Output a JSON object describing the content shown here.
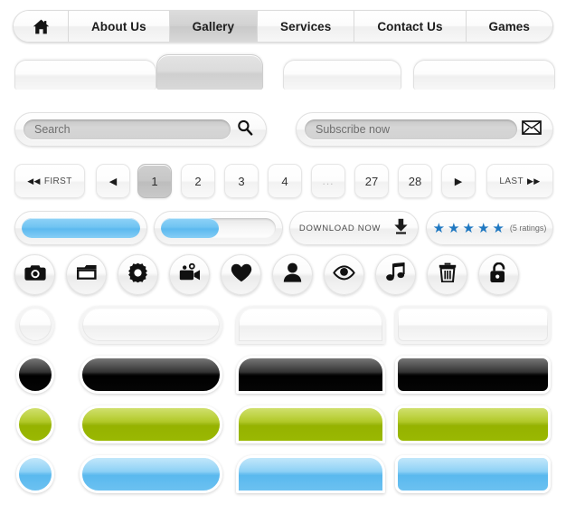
{
  "navbar": {
    "home_icon": "home-icon",
    "items": [
      {
        "label": "About Us",
        "active": false
      },
      {
        "label": "Gallery",
        "active": true
      },
      {
        "label": "Services",
        "active": false
      },
      {
        "label": "Contact Us",
        "active": false
      },
      {
        "label": "Games",
        "active": false
      }
    ]
  },
  "tabs": [
    {
      "label": "",
      "active": false
    },
    {
      "label": "",
      "active": true
    },
    {
      "label": "",
      "active": false
    },
    {
      "label": "",
      "active": false
    }
  ],
  "search": {
    "value": "Search",
    "placeholder": "Search",
    "icon": "search-icon"
  },
  "subscribe": {
    "value": "Subscribe now",
    "placeholder": "Subscribe now",
    "icon": "envelope-icon"
  },
  "pagination": {
    "first_label": "FIRST",
    "last_label": "LAST",
    "prev_icon": "chevron-left-icon",
    "next_icon": "chevron-right-icon",
    "first_icon": "double-chevron-left-icon",
    "last_icon": "double-chevron-right-icon",
    "pages": [
      {
        "label": "1",
        "active": true
      },
      {
        "label": "2",
        "active": false
      },
      {
        "label": "3",
        "active": false
      },
      {
        "label": "4",
        "active": false
      },
      {
        "label": "...",
        "active": false,
        "ellipsis": true
      },
      {
        "label": "27",
        "active": false
      },
      {
        "label": "28",
        "active": false
      }
    ]
  },
  "progress": [
    {
      "name": "progress-full",
      "percent": 100
    },
    {
      "name": "progress-half",
      "percent": 50
    }
  ],
  "download": {
    "label": "DOWNLOAD NOW",
    "icon": "download-icon"
  },
  "rating": {
    "stars": 5,
    "star_glyph": "★",
    "text": "(5 ratings)",
    "color": "#1f78c1"
  },
  "icon_buttons": [
    {
      "name": "camera-icon"
    },
    {
      "name": "folder-icon"
    },
    {
      "name": "gear-icon"
    },
    {
      "name": "video-camera-icon"
    },
    {
      "name": "heart-icon"
    },
    {
      "name": "user-icon"
    },
    {
      "name": "eye-icon"
    },
    {
      "name": "music-note-icon"
    },
    {
      "name": "trash-icon"
    },
    {
      "name": "unlock-icon"
    }
  ],
  "button_rows": [
    {
      "variant": "white",
      "color": "#f8f8f8",
      "shapes": [
        "circle",
        "pill",
        "top",
        "rect"
      ]
    },
    {
      "variant": "black",
      "color": "#000000",
      "shapes": [
        "circle",
        "pill",
        "top",
        "rect"
      ]
    },
    {
      "variant": "green",
      "color": "#9ab802",
      "shapes": [
        "circle",
        "pill",
        "top",
        "rect"
      ]
    },
    {
      "variant": "blue",
      "color": "#6cc1f1",
      "shapes": [
        "circle",
        "pill",
        "top",
        "rect"
      ]
    }
  ]
}
